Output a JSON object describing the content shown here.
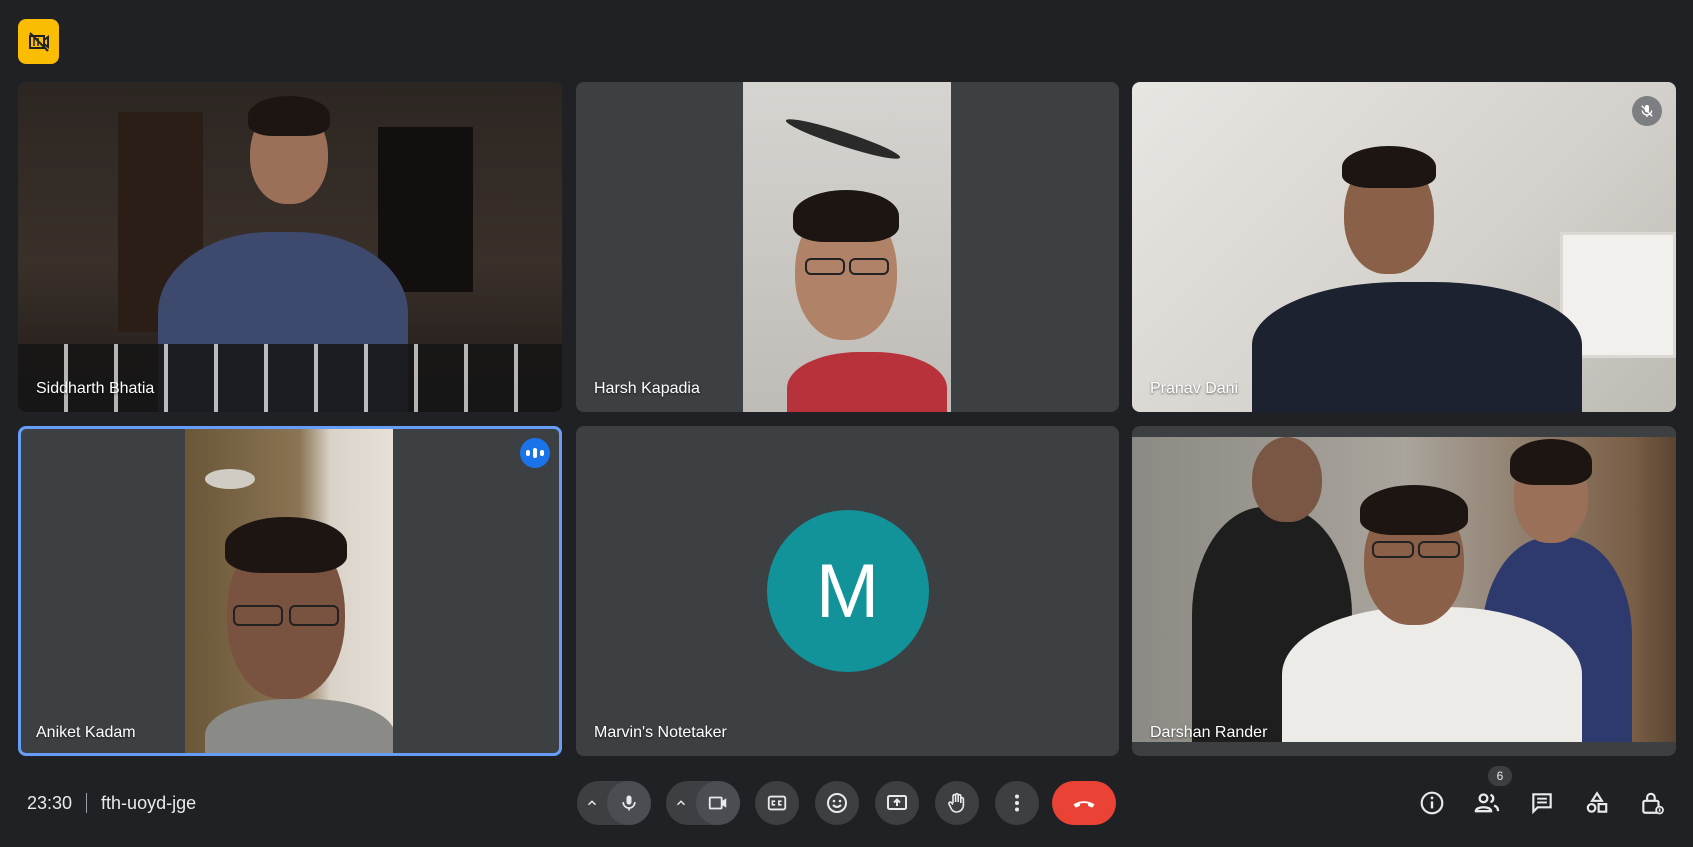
{
  "colors": {
    "background": "#202124",
    "tile": "#3c4043",
    "active_border": "#669df6",
    "end_call": "#ea4335",
    "recording_badge": "#fbbc04",
    "avatar_teal": "#12939a"
  },
  "participants": [
    {
      "name": "Siddharth Bhatia",
      "state": "video"
    },
    {
      "name": "Harsh Kapadia",
      "state": "video"
    },
    {
      "name": "Pranav Dani",
      "state": "video-muted",
      "status_icon": "mic-off-icon"
    },
    {
      "name": "Aniket Kadam",
      "state": "video-speaking",
      "status_icon": "speaking-indicator-icon"
    },
    {
      "name": "Marvin's Notetaker",
      "state": "avatar",
      "avatar_letter": "M"
    },
    {
      "name": "Darshan Rander",
      "state": "video"
    }
  ],
  "meeting": {
    "time": "23:30",
    "code": "fth-uoyd-jge"
  },
  "controls": [
    "mic-icon",
    "camera-icon",
    "captions-icon",
    "emoji-icon",
    "present-icon",
    "raise-hand-icon",
    "more-options-icon",
    "end-call-icon"
  ],
  "right_panel": {
    "icons": [
      "info-icon",
      "people-icon",
      "chat-icon",
      "activities-icon",
      "host-controls-icon"
    ],
    "people_count": "6"
  }
}
